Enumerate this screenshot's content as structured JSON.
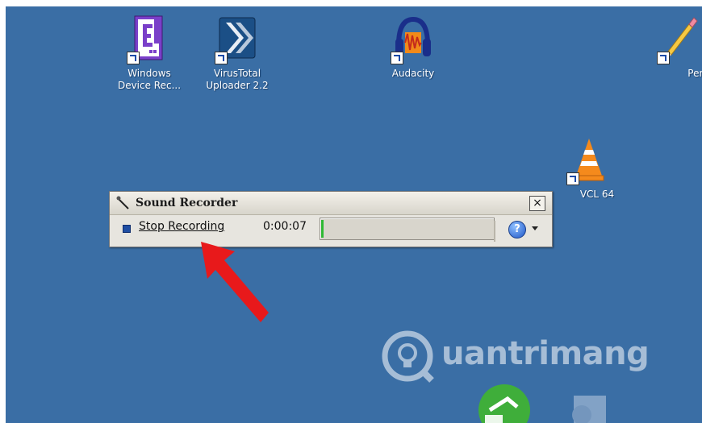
{
  "desktop": {
    "background_color": "#3a6ea5",
    "icons": [
      {
        "name": "windows-device-recovery-icon",
        "label_line1": "Windows",
        "label_line2": "Device Rec..."
      },
      {
        "name": "virustotal-uploader-icon",
        "label_line1": "VirusTotal",
        "label_line2": "Uploader 2.2"
      },
      {
        "name": "audacity-icon",
        "label_line1": "Audacity",
        "label_line2": ""
      },
      {
        "name": "pencil-icon",
        "label_line1": "Penci",
        "label_line2": ""
      },
      {
        "name": "vlc-icon",
        "label_line1": "VCL 64",
        "label_line2": ""
      }
    ]
  },
  "sound_recorder": {
    "title": "Sound Recorder",
    "close_label": "×",
    "stop_label": "Stop Recording",
    "elapsed": "0:00:07",
    "level_fraction": 0.012,
    "help_label": "?",
    "accent_green": "#2fb834",
    "accent_blue": "#1f4ea3"
  },
  "annotation": {
    "arrow_color": "#e8191b"
  },
  "watermark": {
    "text": "uantrimang"
  }
}
